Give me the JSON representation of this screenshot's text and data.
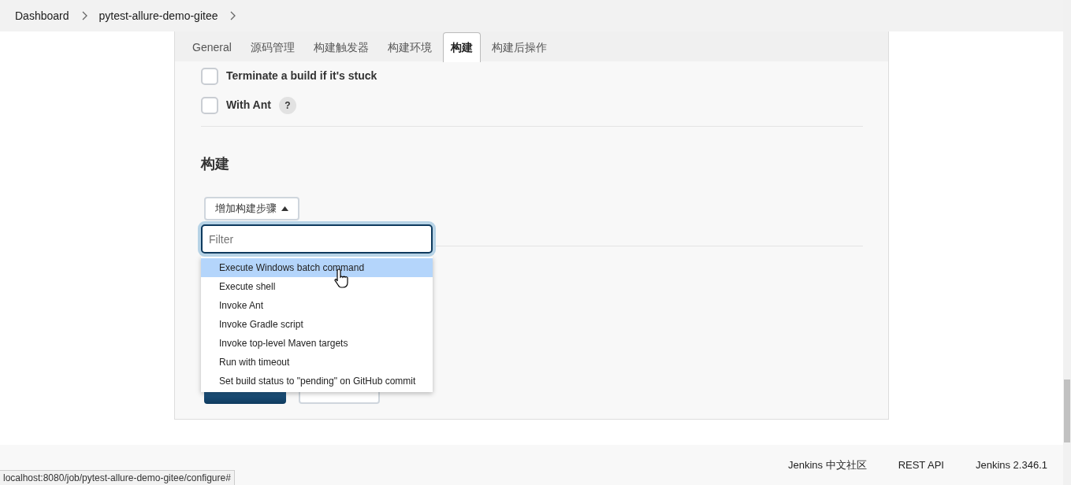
{
  "breadcrumb": [
    {
      "label": "Dashboard"
    },
    {
      "label": "pytest-allure-demo-gitee"
    }
  ],
  "tabs": [
    {
      "label": "General",
      "selected": false
    },
    {
      "label": "源码管理",
      "selected": false
    },
    {
      "label": "构建触发器",
      "selected": false
    },
    {
      "label": "构建环境",
      "selected": false
    },
    {
      "label": "构建",
      "selected": true
    },
    {
      "label": "构建后操作",
      "selected": false
    }
  ],
  "options": [
    {
      "label": "Terminate a build if it's stuck",
      "checked": false
    },
    {
      "label": "With Ant",
      "checked": false,
      "help_mark": "?"
    }
  ],
  "section": {
    "heading": "构建",
    "add_button": "增加构建步骤"
  },
  "dropdown": {
    "placeholder": "Filter",
    "items": [
      {
        "label": "Execute Windows batch command",
        "selected": true
      },
      {
        "label": "Execute shell",
        "selected": false
      },
      {
        "label": "Invoke Ant",
        "selected": false
      },
      {
        "label": "Invoke Gradle script",
        "selected": false
      },
      {
        "label": "Invoke top-level Maven targets",
        "selected": false
      },
      {
        "label": "Run with timeout",
        "selected": false
      },
      {
        "label": "Set build status to \"pending\" on GitHub commit",
        "selected": false
      }
    ]
  },
  "footer": {
    "links": [
      {
        "label": "Jenkins 中文社区"
      },
      {
        "label": "REST API"
      },
      {
        "label": "Jenkins 2.346.1"
      }
    ]
  },
  "status_url": "localhost:8080/job/pytest-allure-demo-gitee/configure#"
}
